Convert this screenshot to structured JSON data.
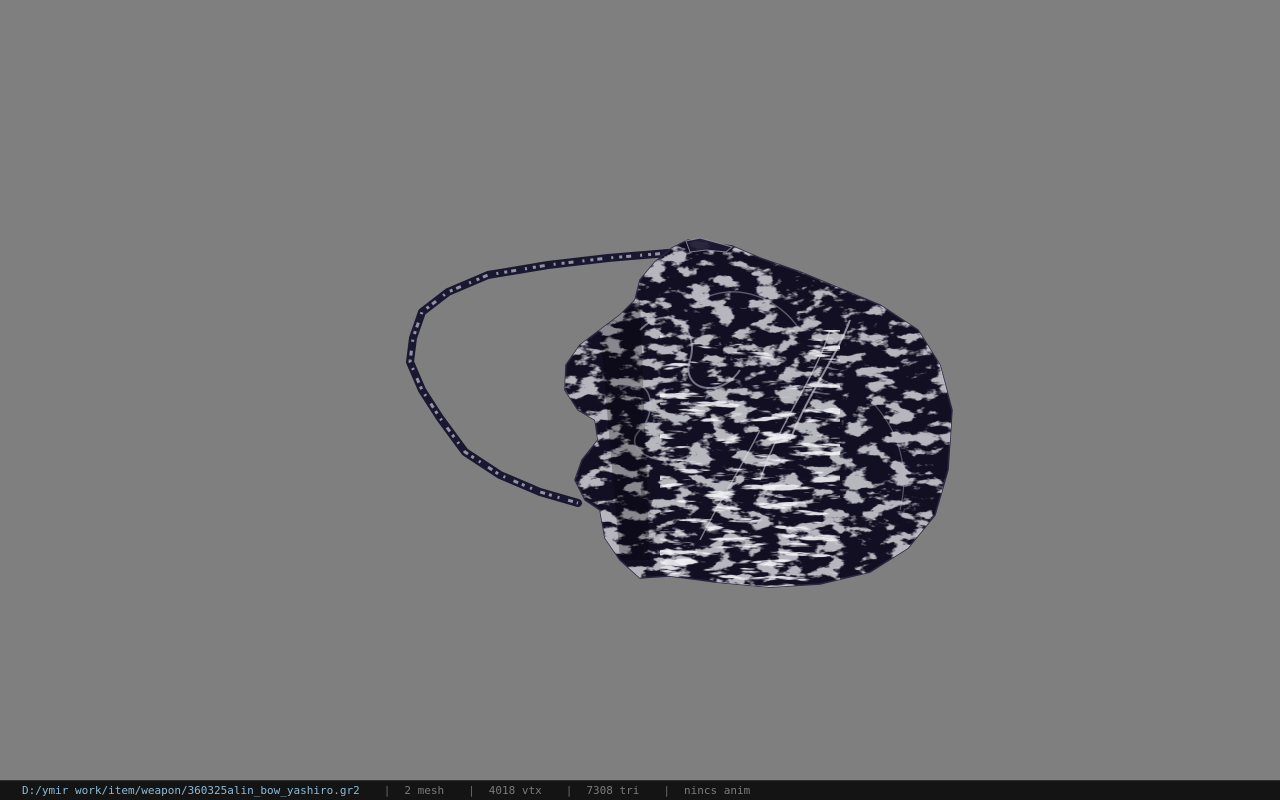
{
  "viewer": {
    "background_color": "#7f7f7f",
    "model": {
      "icon": "textured-bag-model",
      "base_color": "#120f22",
      "highlight_color": "#dcdce6"
    }
  },
  "statusbar": {
    "file_path": "D:/ymir work/item/weapon/360325alin_bow_yashiro.gr2",
    "separator": "|",
    "mesh_count": "2 mesh",
    "vertex_count": "4018 vtx",
    "triangle_count": "7308 tri",
    "anim_status": "nincs anim"
  }
}
